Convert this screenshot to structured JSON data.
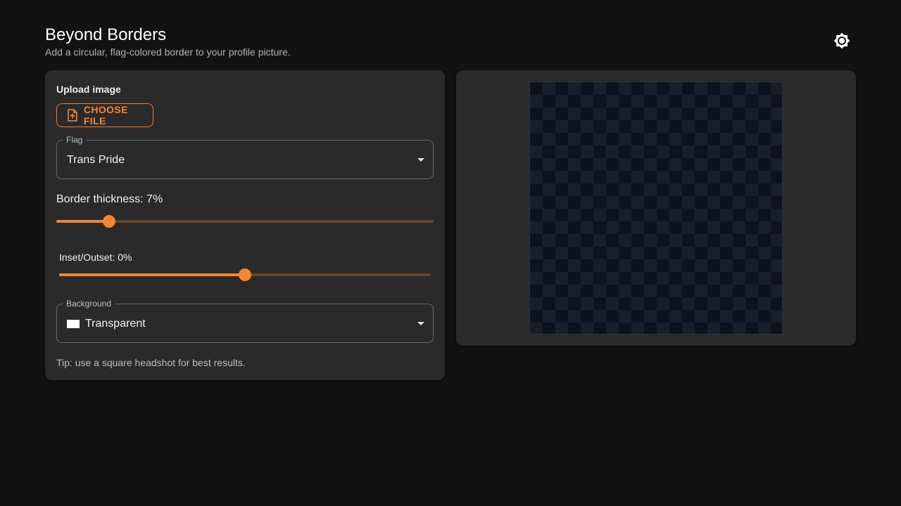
{
  "app": {
    "title": "Beyond Borders",
    "subtitle": "Add a circular, flag-colored border to your profile picture."
  },
  "header": {
    "theme_toggle_icon": "brightness-icon"
  },
  "controls": {
    "upload_label": "Upload image",
    "choose_file_label": "CHOOSE FILE",
    "choose_file_icon": "file-upload-icon",
    "flag": {
      "legend": "Flag",
      "value": "Trans Pride"
    },
    "border_thickness": {
      "label": "Border thickness: 7%",
      "percent": 7
    },
    "inset_outset": {
      "label": "Inset/Outset: 0%",
      "value": 0,
      "position_fraction": 0.5
    },
    "background": {
      "legend": "Background",
      "value": "Transparent",
      "swatch_color": "#ffffff"
    },
    "tip": "Tip: use a square headshot for best results."
  },
  "colors": {
    "accent": "#f5862f",
    "panel": "#2a2a2a",
    "page": "#121212"
  }
}
